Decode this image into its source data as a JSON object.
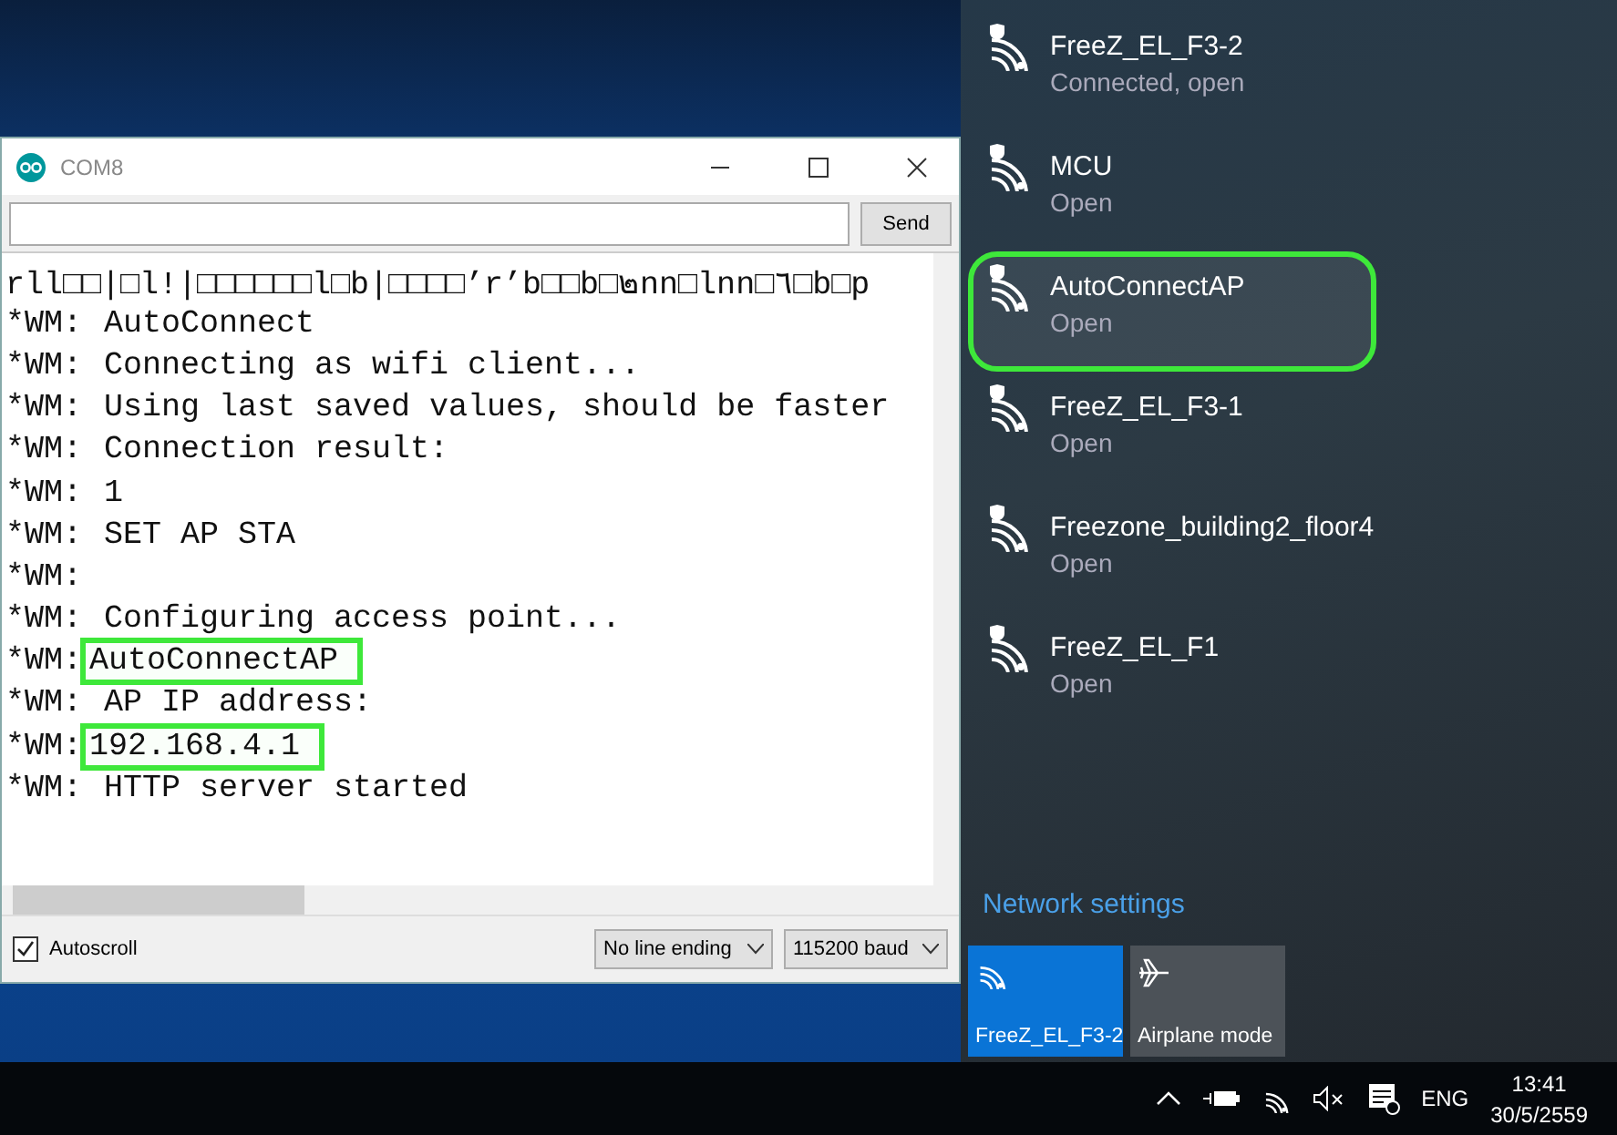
{
  "serial_monitor": {
    "title": "COM8",
    "send_button": "Send",
    "output_lines": [
      {
        "text": "rll□□|□l!|□□□□□□l□b|□□□□’r’b□□b□๒nn□lnn□٦□b□p"
      },
      {
        "prefix": "*WM:",
        "text": "AutoConnect",
        "highlighted": false
      },
      {
        "prefix": "*WM:",
        "text": "Connecting as wifi client...",
        "highlighted": false
      },
      {
        "prefix": "*WM:",
        "text": "Using last saved values, should be faster",
        "highlighted": false
      },
      {
        "prefix": "*WM:",
        "text": "Connection result:",
        "highlighted": false
      },
      {
        "prefix": "*WM:",
        "text": "1",
        "highlighted": false
      },
      {
        "prefix": "*WM:",
        "text": "SET AP STA",
        "highlighted": false
      },
      {
        "prefix": "*WM:"
      },
      {
        "prefix": "*WM:",
        "text": "Configuring access point...",
        "highlighted": false
      },
      {
        "prefix": "*WM:",
        "text": "AutoConnectAP",
        "highlighted": true
      },
      {
        "prefix": "*WM:",
        "text": "AP IP address:",
        "highlighted": false
      },
      {
        "prefix": "*WM:",
        "text": "192.168.4.1",
        "highlighted": true
      },
      {
        "prefix": "*WM:",
        "text": "HTTP server started",
        "highlighted": false
      }
    ],
    "autoscroll": {
      "label": "Autoscroll",
      "checked": true
    },
    "line_ending": "No line ending",
    "baud": "115200 baud"
  },
  "network_flyout": {
    "networks": [
      {
        "name": "FreeZ_EL_F3-2",
        "status": "Connected, open",
        "highlighted": false
      },
      {
        "name": "MCU",
        "status": "Open",
        "highlighted": false
      },
      {
        "name": "AutoConnectAP",
        "status": "Open",
        "highlighted": true
      },
      {
        "name": "FreeZ_EL_F3-1",
        "status": "Open",
        "highlighted": false
      },
      {
        "name": "Freezone_building2_floor4",
        "status": "Open",
        "highlighted": false
      },
      {
        "name": "FreeZ_EL_F1",
        "status": "Open",
        "highlighted": false
      }
    ],
    "settings_link": "Network settings",
    "tiles": [
      {
        "kind": "wifi",
        "label": "FreeZ_EL_F3-2",
        "on": true
      },
      {
        "kind": "airplane",
        "label": "Airplane mode",
        "on": false
      }
    ]
  },
  "taskbar": {
    "language": "ENG",
    "time": "13:41",
    "date": "30/5/2559"
  }
}
